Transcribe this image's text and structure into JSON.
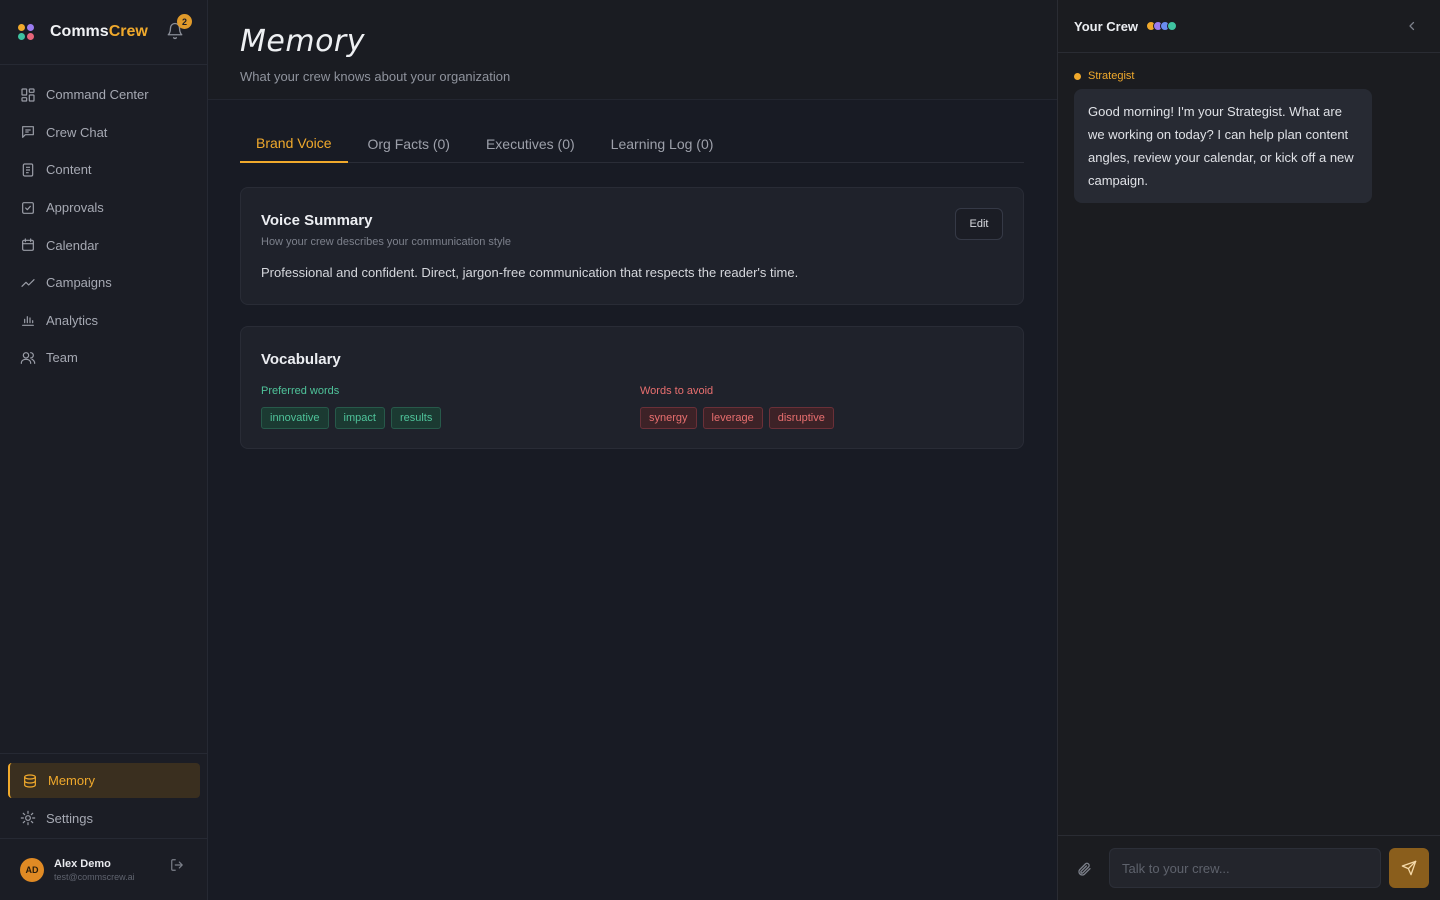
{
  "brand": {
    "name_part1": "Comms",
    "name_part2": "Crew",
    "notifications": "2",
    "logo_colors": [
      "#f0a92c",
      "#9b7cf0",
      "#3fc3a0",
      "#e8657a"
    ]
  },
  "sidebar": {
    "items": [
      {
        "label": "Command Center",
        "icon": "grid-icon"
      },
      {
        "label": "Crew Chat",
        "icon": "chat-icon"
      },
      {
        "label": "Content",
        "icon": "document-icon"
      },
      {
        "label": "Approvals",
        "icon": "checkbox-icon"
      },
      {
        "label": "Calendar",
        "icon": "calendar-icon"
      },
      {
        "label": "Campaigns",
        "icon": "trend-icon"
      },
      {
        "label": "Analytics",
        "icon": "bar-chart-icon"
      },
      {
        "label": "Team",
        "icon": "users-icon"
      }
    ],
    "bottom_items": [
      {
        "label": "Memory",
        "icon": "database-icon",
        "active": true
      },
      {
        "label": "Settings",
        "icon": "gear-icon"
      }
    ]
  },
  "user": {
    "initials": "AD",
    "name": "Alex Demo",
    "email": "test@commscrew.ai"
  },
  "page": {
    "title": "Memory",
    "subtitle": "What your crew knows about your organization"
  },
  "tabs": [
    {
      "label": "Brand Voice",
      "active": true
    },
    {
      "label": "Org Facts (0)"
    },
    {
      "label": "Executives (0)"
    },
    {
      "label": "Learning Log (0)"
    }
  ],
  "voice_summary": {
    "title": "Voice Summary",
    "subtitle": "How your crew describes your communication style",
    "edit_label": "Edit",
    "text": "Professional and confident. Direct, jargon-free communication that respects the reader's time."
  },
  "vocabulary": {
    "title": "Vocabulary",
    "preferred_label": "Preferred words",
    "preferred": [
      "innovative",
      "impact",
      "results"
    ],
    "avoid_label": "Words to avoid",
    "avoid": [
      "synergy",
      "leverage",
      "disruptive"
    ]
  },
  "panel": {
    "title": "Your Crew",
    "crew_colors": [
      "#f0a92c",
      "#9b7cf0",
      "#6a8cf0",
      "#3fc3a0"
    ],
    "agent_name": "Strategist",
    "message": "Good morning! I'm your Strategist. What are we working on today? I can help plan content angles, review your calendar, or kick off a new campaign.",
    "input_placeholder": "Talk to your crew..."
  },
  "colors": {
    "accent": "#f0a92c",
    "preferred": "#4fc39a",
    "avoid": "#e86f6f"
  }
}
